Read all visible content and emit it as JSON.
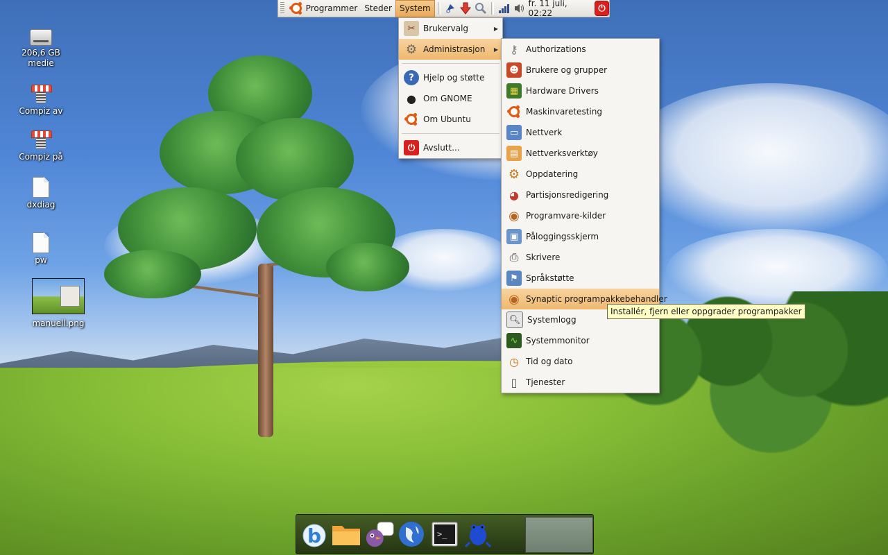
{
  "panel": {
    "applications": "Programmer",
    "places": "Steder",
    "system": "System",
    "clock": "fr. 11 juli, 02:22"
  },
  "desktop": {
    "icons": [
      {
        "label": "206,6 GB\nmedie",
        "line1": "206,6 GB",
        "line2": "medie",
        "icon": "drive-icon"
      },
      {
        "label": "Compiz av",
        "icon": "compiz-spring-icon"
      },
      {
        "label": "Compiz på",
        "icon": "compiz-spring-icon"
      },
      {
        "label": "dxdiag",
        "icon": "document-icon"
      },
      {
        "label": "pw",
        "icon": "document-icon"
      },
      {
        "label": "manuell.png",
        "icon": "image-thumbnail"
      }
    ]
  },
  "system_menu": {
    "items": [
      {
        "label": "Brukervalg",
        "icon": "preferences-icon",
        "submenu": true
      },
      {
        "label": "Administrasjon",
        "icon": "administration-gear-icon",
        "submenu": true
      },
      {
        "label": "Hjelp og støtte",
        "icon": "help-icon"
      },
      {
        "label": "Om GNOME",
        "icon": "gnome-foot-icon"
      },
      {
        "label": "Om Ubuntu",
        "icon": "ubuntu-icon"
      },
      {
        "label": "Avslutt...",
        "icon": "power-icon"
      }
    ]
  },
  "admin_menu": {
    "items": [
      {
        "label": "Authorizations",
        "icon": "keys-icon"
      },
      {
        "label": "Brukere og grupper",
        "icon": "users-groups-icon"
      },
      {
        "label": "Hardware Drivers",
        "icon": "hardware-card-icon"
      },
      {
        "label": "Maskinvaretesting",
        "icon": "ubuntu-icon"
      },
      {
        "label": "Nettverk",
        "icon": "network-icon"
      },
      {
        "label": "Nettverksverktøy",
        "icon": "network-tools-icon"
      },
      {
        "label": "Oppdatering",
        "icon": "update-icon"
      },
      {
        "label": "Partisjonsredigering",
        "icon": "partition-icon"
      },
      {
        "label": "Programvare-kilder",
        "icon": "software-sources-icon"
      },
      {
        "label": "Påloggingsskjerm",
        "icon": "login-screen-icon"
      },
      {
        "label": "Skrivere",
        "icon": "printer-icon"
      },
      {
        "label": "Språkstøtte",
        "icon": "language-flag-icon"
      },
      {
        "label": "Synaptic programpakkebehandler",
        "icon": "synaptic-icon"
      },
      {
        "label": "Systemlogg",
        "icon": "system-log-icon"
      },
      {
        "label": "Systemmonitor",
        "icon": "system-monitor-icon"
      },
      {
        "label": "Tid og dato",
        "icon": "clock-icon"
      },
      {
        "label": "Tjenester",
        "icon": "services-icon"
      }
    ]
  },
  "tooltip": "Installér, fjern eller oppgrader programpakker",
  "dock": {
    "items": [
      "browser-b-icon",
      "file-manager-icon",
      "pidgin-chat-icon",
      "globe-icon",
      "terminal-icon",
      "frog-icon"
    ]
  },
  "colors": {
    "highlight": "#efb86e",
    "menu_bg": "#f6f5f2",
    "tooltip_bg": "#ffffc4",
    "ubuntu_orange": "#e05a12",
    "power_red": "#d9201e"
  }
}
